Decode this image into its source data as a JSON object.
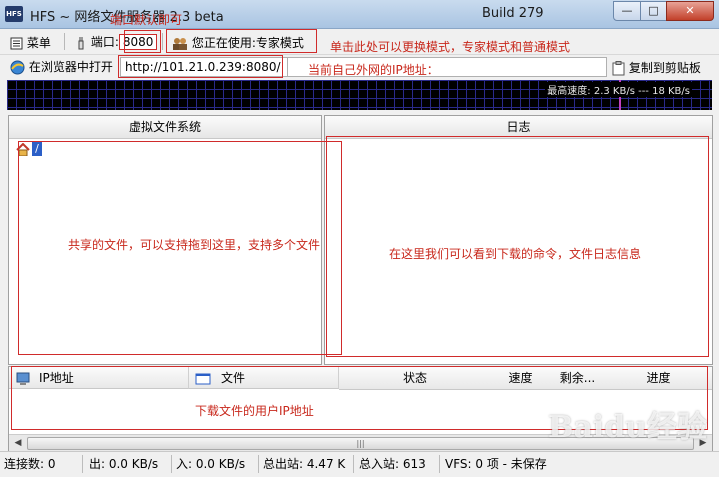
{
  "window": {
    "icon_text": "HFS",
    "title": "HFS ~ 网络文件服务器 2.3 beta",
    "build": "Build 279",
    "controls": {
      "minimize": "—",
      "maximize": "□",
      "close": "✕"
    }
  },
  "toolbar": {
    "menu_label": "菜单",
    "port_label": "端口:",
    "port_value": "8080",
    "mode_label": "您正在使用:专家模式",
    "open_in_browser_label": "在浏览器中打开",
    "url_value": "http://101.21.0.239:8080/",
    "copy_clipboard_label": "复制到剪贴板"
  },
  "graph": {
    "label": "最高速度: 2.3 KB/s --- 18 KB/s"
  },
  "panels": {
    "vfs_title": "虚拟文件系统",
    "vfs_root": "/",
    "log_title": "日志"
  },
  "connections": {
    "columns": [
      "IP地址",
      "文件",
      "状态",
      "速度",
      "剩余...",
      "进度"
    ]
  },
  "annotations": {
    "port_note": "端口默认即可",
    "mode_note": "单击此处可以更换模式，专家模式和普通模式",
    "ip_note": "当前自己外网的IP地址：",
    "vfs_note": "共享的文件，可以支持拖到这里，支持多个文件",
    "log_note": "在这里我们可以看到下载的命令，文件日志信息",
    "users_note": "下载文件的用户IP地址"
  },
  "status_bar": {
    "connections": "连接数: 0",
    "out": "出: 0.0 KB/s",
    "in": "入: 0.0 KB/s",
    "total_out": "总出站: 4.47 K",
    "total_in": "总入站: 613",
    "vfs": "VFS: 0 项 - 未保存"
  },
  "watermark": "Baidu经验",
  "colors": {
    "annotation_red": "#c8281c",
    "graph_bg": "#000000",
    "titlebar": "#b9d0e8"
  }
}
